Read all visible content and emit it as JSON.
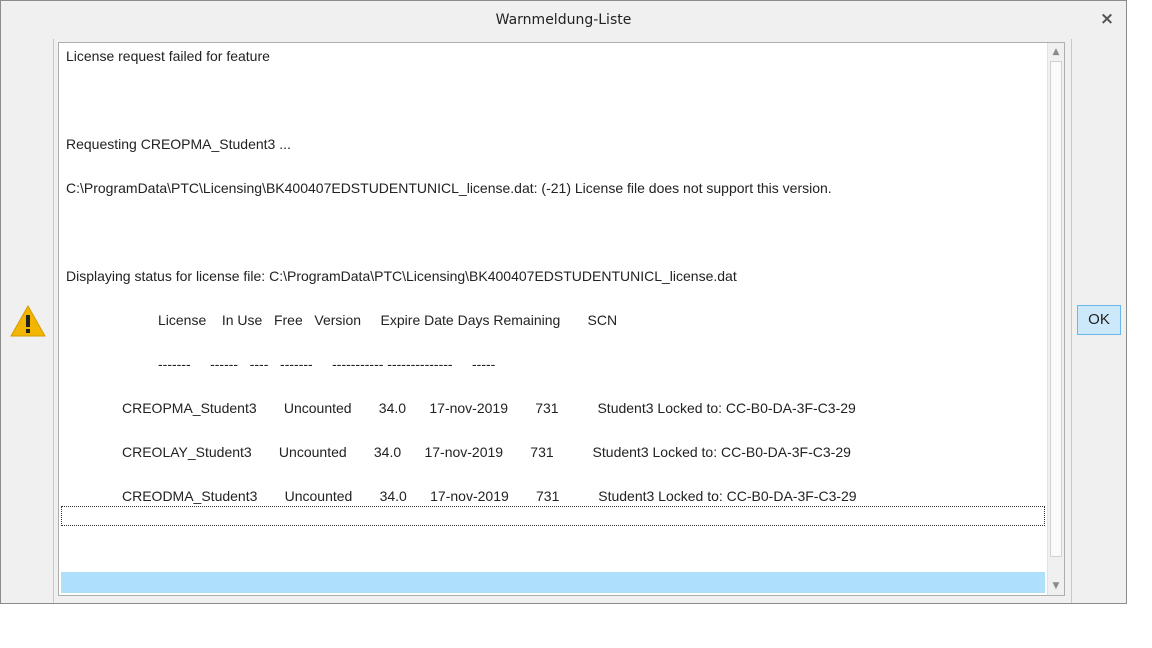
{
  "window": {
    "title": "Warnmeldung-Liste",
    "close_glyph": "×"
  },
  "icon": {
    "name": "warning-icon",
    "color": "#f2b600"
  },
  "lines": [
    {
      "text": "License request failed for feature"
    },
    {
      "text": "Requesting CREOPMA_Student3 ..."
    },
    {
      "text": "C:\\ProgramData\\PTC\\Licensing\\BK400407EDSTUDENTUNICL_license.dat: (-21) License file does not support this version."
    },
    {
      "text": "Displaying status for license file: C:\\ProgramData\\PTC\\Licensing\\BK400407EDSTUDENTUNICL_license.dat"
    },
    {
      "text": "License    In Use   Free   Version     Expire Date Days Remaining       SCN"
    },
    {
      "text": "-------     ------   ----   -------     ----------- --------------     -----"
    },
    {
      "text": "CREOPMA_Student3       Uncounted       34.0      17-nov-2019       731          Student3 Locked to: CC-B0-DA-3F-C3-29"
    },
    {
      "text": "CREOLAY_Student3       Uncounted       34.0      17-nov-2019       731          Student3 Locked to: CC-B0-DA-3F-C3-29"
    },
    {
      "text": "CREODMA_Student3       Uncounted       34.0      17-nov-2019       731          Student3 Locked to: CC-B0-DA-3F-C3-29"
    }
  ],
  "buttons": {
    "ok": "OK"
  },
  "scroll": {
    "up": "▲",
    "down": "▼"
  }
}
